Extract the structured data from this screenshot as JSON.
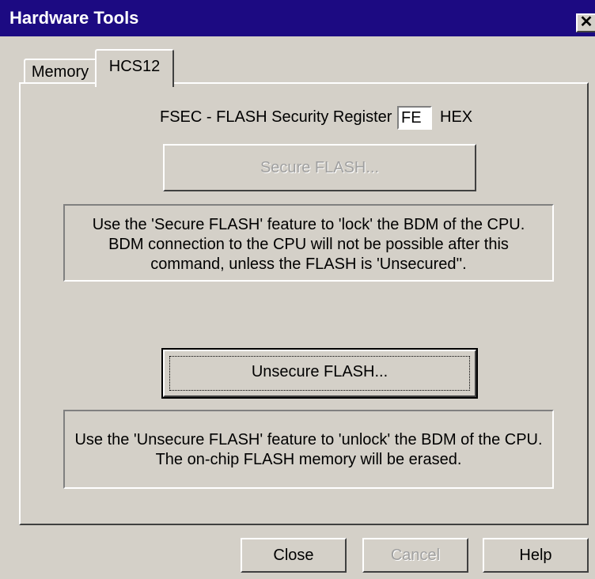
{
  "window": {
    "title": "Hardware Tools",
    "close_glyph": "✕"
  },
  "tabs": [
    {
      "label": "Memory",
      "active": false
    },
    {
      "label": "HCS12",
      "active": true
    }
  ],
  "fsec": {
    "label": "FSEC - FLASH Security Register",
    "value": "FE",
    "unit": "HEX"
  },
  "secure": {
    "button_label": "Secure FLASH...",
    "enabled": false,
    "info_lines": [
      "Use the 'Secure FLASH' feature to 'lock' the BDM of the CPU.",
      "BDM connection to the CPU will not be possible after this",
      "command, unless the FLASH is 'Unsecured''."
    ]
  },
  "unsecure": {
    "button_label": "Unsecure FLASH...",
    "enabled": true,
    "info_lines": [
      "Use the 'Unsecure FLASH' feature to 'unlock' the BDM of the CPU.",
      "The on-chip FLASH memory will be erased."
    ]
  },
  "buttons": {
    "close": "Close",
    "cancel": "Cancel",
    "help": "Help"
  },
  "colors": {
    "titlebar": "#1c0a82",
    "face": "#d4d0c8",
    "disabled_text": "#a0a0a0"
  }
}
